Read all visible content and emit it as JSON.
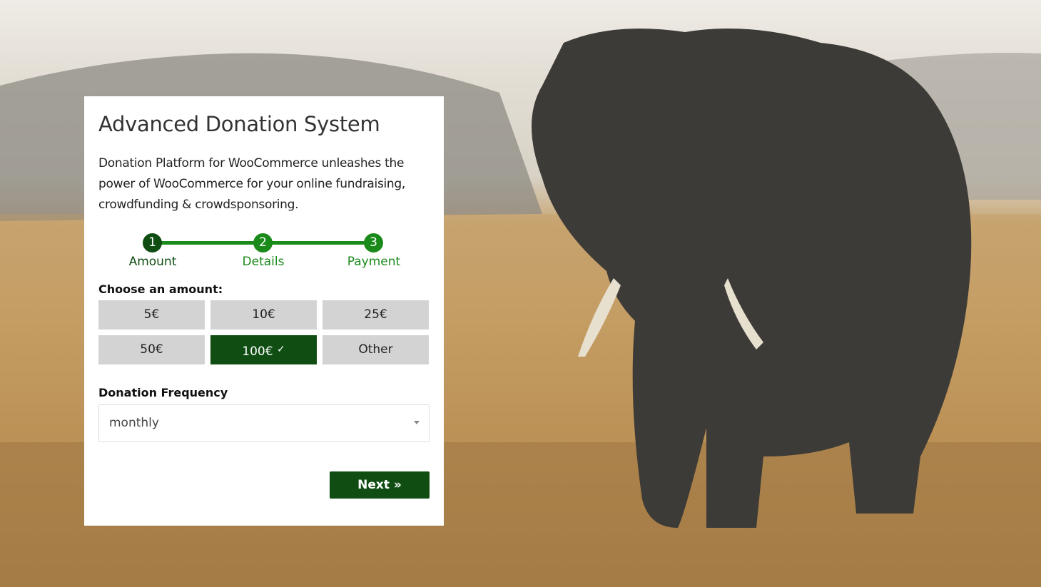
{
  "card": {
    "title": "Advanced Donation System",
    "description": "Donation Platform for WooCommerce unleashes the power of WooCommerce for your online fundraising, crowdfunding & crowdsponsoring.",
    "steps": [
      {
        "number": "1",
        "label": "Amount",
        "active": true
      },
      {
        "number": "2",
        "label": "Details",
        "active": false
      },
      {
        "number": "3",
        "label": "Payment",
        "active": false
      }
    ],
    "amount_label": "Choose an amount:",
    "amounts": [
      "5€",
      "10€",
      "25€",
      "50€",
      "100€",
      "Other"
    ],
    "selected_amount": "100€",
    "selected_check": "✓",
    "frequency_label": "Donation Frequency",
    "frequency_value": "monthly",
    "next_label": "Next »"
  },
  "colors": {
    "primary_dark": "#0f4d12",
    "step_green": "#1a8a1a",
    "amount_bg": "#d3d3d3"
  }
}
